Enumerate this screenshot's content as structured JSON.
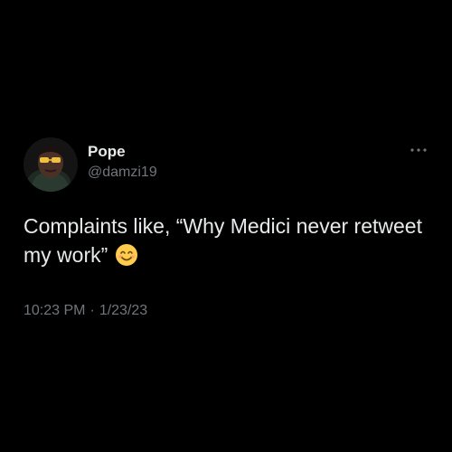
{
  "author": {
    "display_name": "Pope",
    "handle": "@damzi19",
    "avatar": "avatar"
  },
  "tweet": {
    "text": "Complaints like, “Why Medici never retweet my work”",
    "emoji": "smiling-face-icon",
    "time": "10:23 PM",
    "separator": "·",
    "date": "1/23/23"
  },
  "menu": {
    "icon": "more-icon"
  },
  "colors": {
    "background": "#000000",
    "primary_text": "#e7e9ea",
    "secondary_text": "#71767b"
  }
}
